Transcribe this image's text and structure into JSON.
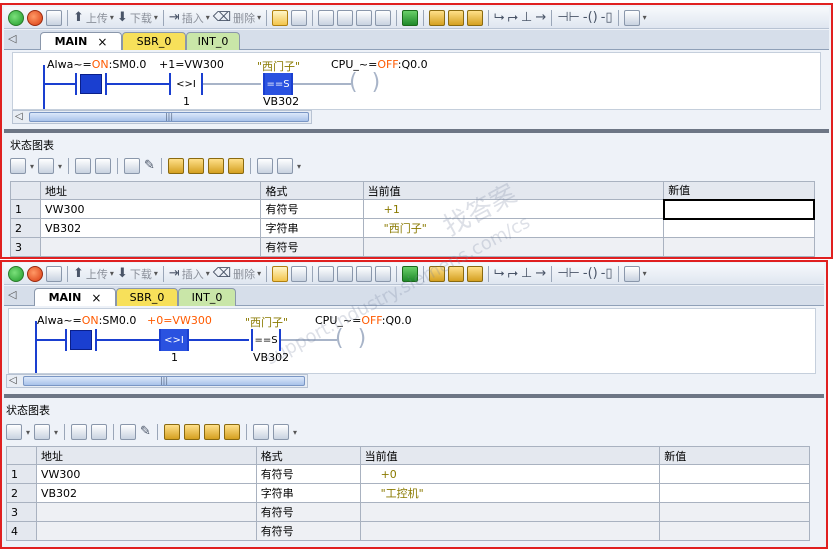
{
  "toolbar": {
    "upload_label": "上传",
    "download_label": "下载",
    "insert_label": "插入",
    "delete_label": "删除"
  },
  "tabs": [
    {
      "label": "MAIN"
    },
    {
      "label": "SBR_0"
    },
    {
      "label": "INT_0"
    }
  ],
  "status_chart": {
    "title": "状态图表",
    "columns": [
      "地址",
      "格式",
      "当前值",
      "新值"
    ]
  },
  "top": {
    "ladder": {
      "contact1_prefix": "Alwa~=",
      "contact1_state": "ON",
      "contact1_addr": ":SM0.0",
      "compare_label": "+1=VW300",
      "compare_op": "<>I",
      "compare_operand": "1",
      "string_value": "\"西门子\"",
      "string_op": "==S",
      "string_operand": "VB302",
      "coil_prefix": "CPU_~=",
      "coil_state": "OFF",
      "coil_addr": ":Q0.0"
    },
    "rows": [
      {
        "idx": "1",
        "addr": "VW300",
        "format": "有符号",
        "current": "+1",
        "new": ""
      },
      {
        "idx": "2",
        "addr": "VB302",
        "format": "字符串",
        "current": "\"西门子\"",
        "new": ""
      },
      {
        "idx": "3",
        "addr": "",
        "format": "有符号",
        "current": "",
        "new": ""
      }
    ]
  },
  "bottom": {
    "ladder": {
      "contact1_prefix": "Alwa~=",
      "contact1_state": "ON",
      "contact1_addr": ":SM0.0",
      "compare_label": "+0=VW300",
      "compare_op": "<>I",
      "compare_operand": "1",
      "string_value": "\"西门子\"",
      "string_op": "==S",
      "string_operand": "VB302",
      "coil_prefix": "CPU_~=",
      "coil_state": "OFF",
      "coil_addr": ":Q0.0"
    },
    "rows": [
      {
        "idx": "1",
        "addr": "VW300",
        "format": "有符号",
        "current": "+0",
        "new": ""
      },
      {
        "idx": "2",
        "addr": "VB302",
        "format": "字符串",
        "current": "\"工控机\"",
        "new": ""
      },
      {
        "idx": "3",
        "addr": "",
        "format": "有符号",
        "current": "",
        "new": ""
      },
      {
        "idx": "4",
        "addr": "",
        "format": "有符号",
        "current": "",
        "new": ""
      }
    ]
  },
  "watermark": {
    "line1": "找答案",
    "line2": "support.industry.siemens.com/cs"
  },
  "colors": {
    "highlight_border": "#e02020",
    "ladder_blue": "#1a3fd0",
    "state_orange": "#ff5a00",
    "string_olive": "#8a7a00"
  }
}
